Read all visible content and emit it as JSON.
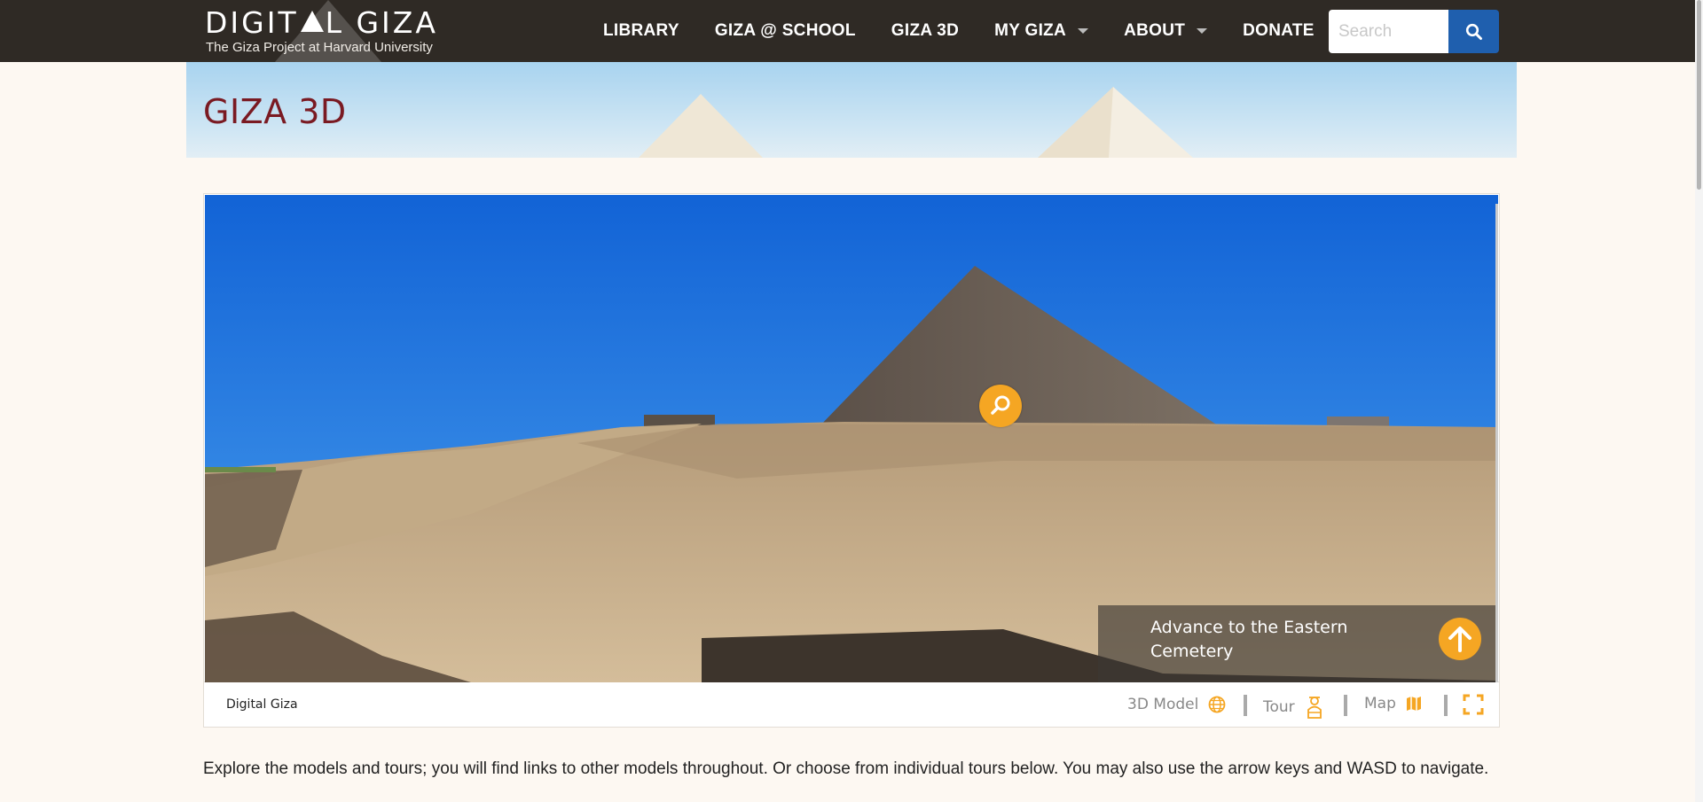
{
  "header": {
    "logo_title_a": "DIGIT",
    "logo_title_b": "L GIZA",
    "logo_subtitle": "The Giza Project at Harvard University"
  },
  "nav": {
    "items": [
      {
        "label": "LIBRARY",
        "has_caret": false
      },
      {
        "label": "GIZA @ SCHOOL",
        "has_caret": false
      },
      {
        "label": "GIZA 3D",
        "has_caret": false
      },
      {
        "label": "MY GIZA",
        "has_caret": true
      },
      {
        "label": "ABOUT",
        "has_caret": true
      },
      {
        "label": "DONATE",
        "has_caret": false
      }
    ],
    "search_placeholder": "Search"
  },
  "page": {
    "title": "GIZA 3D",
    "intro": "Explore the models and tours; you will find links to other models throughout. Or choose from individual tours below. You may also use the arrow keys and WASD to navigate."
  },
  "viewer": {
    "advance_label": "Advance to the Eastern Cemetery",
    "credit": "Digital Giza",
    "controls": {
      "model_label": "3D Model",
      "tour_label": "Tour",
      "map_label": "Map"
    }
  },
  "colors": {
    "nav_bg": "#2f2a25",
    "title": "#7a1a22",
    "accent": "#f5a623",
    "search_btn": "#1f5fae",
    "page_bg": "#fdf8f2"
  },
  "icons": {
    "hotspot": "magnifier-icon",
    "advance": "arrow-up-icon",
    "model": "globe-icon",
    "tour": "guide-icon",
    "map": "map-icon",
    "fullscreen": "fullscreen-icon",
    "search": "search-icon"
  }
}
